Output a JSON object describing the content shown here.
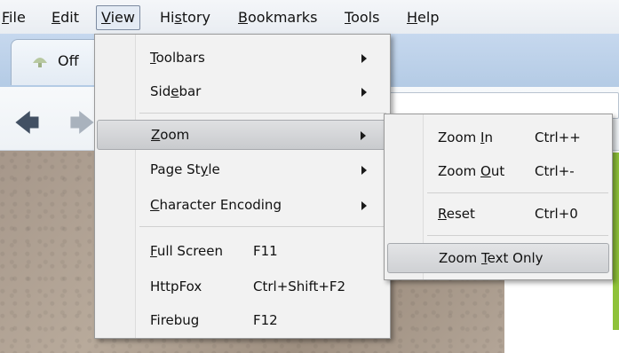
{
  "menubar": {
    "items": [
      {
        "pre": "",
        "ul": "F",
        "post": "ile"
      },
      {
        "pre": "",
        "ul": "E",
        "post": "dit"
      },
      {
        "pre": "",
        "ul": "V",
        "post": "iew"
      },
      {
        "pre": "Hi",
        "ul": "s",
        "post": "tory"
      },
      {
        "pre": "",
        "ul": "B",
        "post": "ookmarks"
      },
      {
        "pre": "",
        "ul": "T",
        "post": "ools"
      },
      {
        "pre": "",
        "ul": "H",
        "post": "elp"
      }
    ]
  },
  "tab": {
    "title": "Off"
  },
  "view_menu": {
    "items": [
      {
        "pre": "",
        "ul": "T",
        "post": "oolbars",
        "shortcut": ""
      },
      {
        "pre": "Sid",
        "ul": "e",
        "post": "bar",
        "shortcut": ""
      },
      {
        "pre": "",
        "ul": "Z",
        "post": "oom",
        "shortcut": ""
      },
      {
        "pre": "Page St",
        "ul": "y",
        "post": "le",
        "shortcut": ""
      },
      {
        "pre": "",
        "ul": "C",
        "post": "haracter Encoding",
        "shortcut": ""
      },
      {
        "pre": "",
        "ul": "F",
        "post": "ull Screen",
        "shortcut": "F11"
      },
      {
        "pre": "HttpFox",
        "ul": "",
        "post": "",
        "shortcut": "Ctrl+Shift+F2"
      },
      {
        "pre": "Firebug",
        "ul": "",
        "post": "",
        "shortcut": "F12"
      }
    ]
  },
  "zoom_submenu": {
    "items": [
      {
        "pre": "Zoom ",
        "ul": "I",
        "post": "n",
        "shortcut": "Ctrl++"
      },
      {
        "pre": "Zoom ",
        "ul": "O",
        "post": "ut",
        "shortcut": "Ctrl+-"
      },
      {
        "pre": "",
        "ul": "R",
        "post": "eset",
        "shortcut": "Ctrl+0"
      },
      {
        "pre": "Zoom ",
        "ul": "T",
        "post": "ext Only",
        "shortcut": ""
      }
    ]
  },
  "colors": {
    "menu_bg": "#f2f2f2",
    "highlight": "#c9cbce",
    "chrome_blue": "#bcd0e6"
  },
  "icons": {
    "tab": "gray-favicon",
    "back": "back-arrow-icon",
    "forward": "forward-arrow-icon",
    "submenu": "chevron-right-icon"
  }
}
